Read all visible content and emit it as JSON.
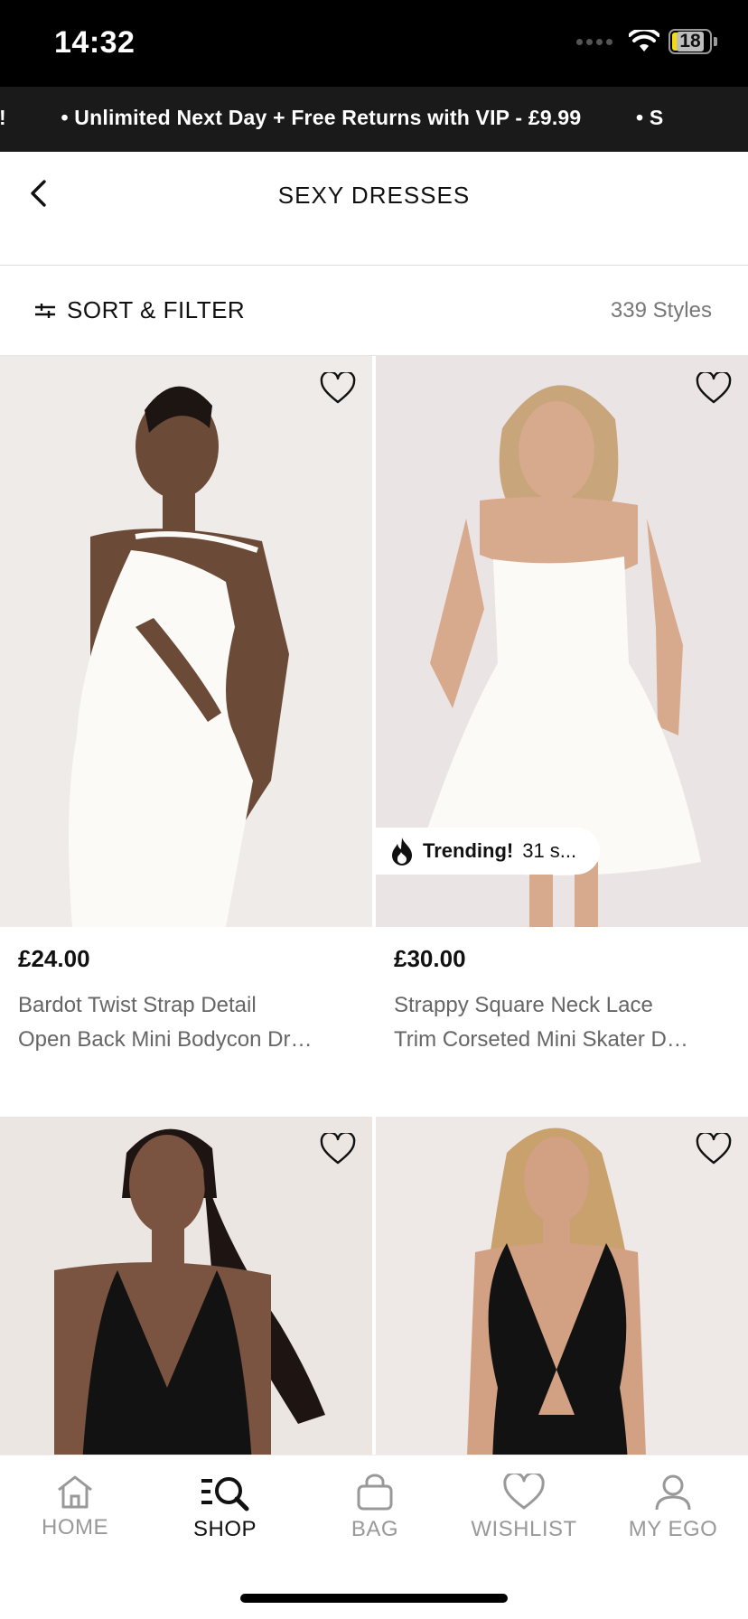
{
  "status_bar": {
    "time": "14:32",
    "battery": "18"
  },
  "promo": {
    "messages": [
      "s!",
      "• Unlimited Next Day + Free Returns with VIP - £9.99",
      "• S"
    ]
  },
  "header": {
    "title": "SEXY DRESSES"
  },
  "filter_bar": {
    "sort_filter_label": "SORT & FILTER",
    "styles_count": "339 Styles"
  },
  "products": [
    {
      "price": "£24.00",
      "name_line1": "Bardot Twist Strap Detail",
      "name_line2": "Open Back Mini Bodycon Dr…",
      "dress_color": "#fbfaf6"
    },
    {
      "price": "£30.00",
      "name_line1": "Strappy Square Neck Lace",
      "name_line2": "Trim Corseted Mini Skater D…",
      "dress_color": "#fbfaf6",
      "badge": {
        "strong": "Trending!",
        "rest": "31 s..."
      }
    },
    {
      "dress_color": "#121212"
    },
    {
      "dress_color": "#121212"
    }
  ],
  "tabbar": {
    "items": [
      {
        "label": "HOME",
        "icon": "home-icon"
      },
      {
        "label": "SHOP",
        "icon": "shop-search-icon"
      },
      {
        "label": "BAG",
        "icon": "bag-icon"
      },
      {
        "label": "WISHLIST",
        "icon": "heart-icon"
      },
      {
        "label": "MY EGO",
        "icon": "person-icon"
      }
    ],
    "active": "SHOP"
  }
}
